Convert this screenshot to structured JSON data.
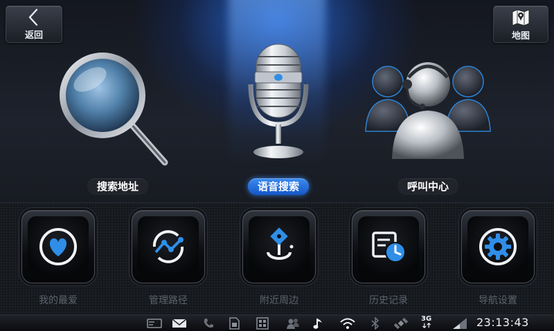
{
  "header": {
    "back_label": "返回",
    "map_label": "地图"
  },
  "features": [
    {
      "label": "搜索地址",
      "icon": "magnifier-icon",
      "active": false
    },
    {
      "label": "语音搜索",
      "icon": "microphone-icon",
      "active": true
    },
    {
      "label": "呼叫中心",
      "icon": "call-center-icon",
      "active": false
    }
  ],
  "tiles": [
    {
      "label": "我的最爱",
      "icon": "heart-icon"
    },
    {
      "label": "管理路径",
      "icon": "route-icon"
    },
    {
      "label": "附近周边",
      "icon": "nearby-pin-icon"
    },
    {
      "label": "历史记录",
      "icon": "history-icon"
    },
    {
      "label": "导航设置",
      "icon": "settings-gear-icon"
    }
  ],
  "status_bar": {
    "time": "23:13:43",
    "network": "3G",
    "icons": [
      "card-icon",
      "mail-icon",
      "phone-icon",
      "sim-icon",
      "sim2-icon",
      "contacts-icon",
      "music-icon",
      "wifi-icon",
      "bluetooth-icon",
      "satellite-icon",
      "network-3g-icon",
      "signal-icon"
    ]
  },
  "colors": {
    "accent": "#2a7be4",
    "tile_label": "#5d626b",
    "icon_blue": "#2f8ee8"
  }
}
